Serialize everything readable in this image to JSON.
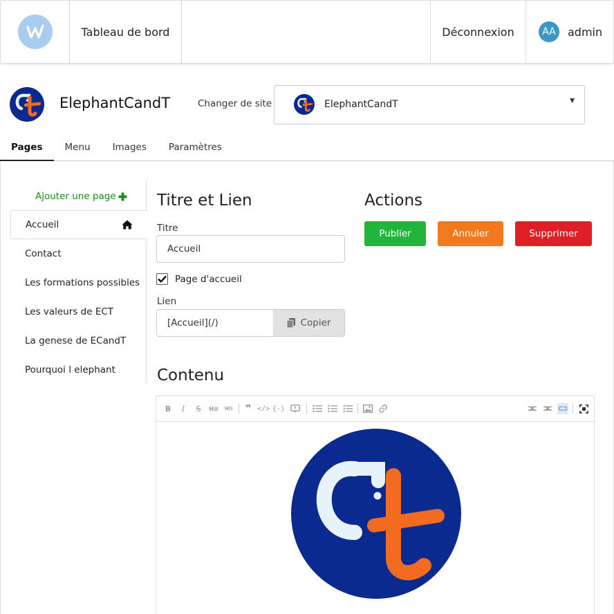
{
  "navbar": {
    "logo_icon": "w-logo-icon",
    "dashboard_label": "Tableau de bord",
    "logout_label": "Déconnexion",
    "avatar_initials": "AA",
    "username": "admin"
  },
  "site": {
    "name": "ElephantCandT",
    "change_label": "Changer de site :",
    "selected": "ElephantCandT",
    "brand_colors": {
      "navy": "#0b2a8f",
      "orange": "#f26b21",
      "light": "#e8f2fb"
    }
  },
  "tabs": [
    {
      "label": "Pages",
      "active": true
    },
    {
      "label": "Menu"
    },
    {
      "label": "Images"
    },
    {
      "label": "Paramètres"
    }
  ],
  "sidebar": {
    "add_page_label": "Ajouter une page",
    "items": [
      {
        "label": "Accueil",
        "active": true,
        "icon": "home-icon"
      },
      {
        "label": "Contact"
      },
      {
        "label": "Les formations possibles"
      },
      {
        "label": "Les valeurs de ECT"
      },
      {
        "label": "La genese de ECandT"
      },
      {
        "label": "Pourquoi l elephant"
      }
    ]
  },
  "form": {
    "section_title": "Titre et Lien",
    "title_label": "Titre",
    "title_value": "Accueil",
    "homepage_checkbox_label": "Page d'accueil",
    "homepage_checked": true,
    "link_label": "Lien",
    "link_value": "[Accueil](/)",
    "copy_label": "Copier"
  },
  "actions": {
    "title": "Actions",
    "publish_label": "Publier",
    "cancel_label": "Annuler",
    "delete_label": "Supprimer",
    "colors": {
      "publish": "#21b53c",
      "cancel": "#f07a1c",
      "delete": "#df1f26"
    }
  },
  "content": {
    "title": "Contenu",
    "toolbar_icons": [
      "bold-icon",
      "italic-icon",
      "strikethrough-icon",
      "heading-bigger-icon",
      "heading-smaller-icon",
      "quote-icon",
      "code-icon",
      "code-block-icon",
      "comment-icon",
      "bullet-list-icon",
      "numbered-list-icon",
      "checklist-icon",
      "image-icon",
      "link-icon",
      "toggle-preview-icon",
      "side-by-side-icon",
      "toggle-edit-icon",
      "fullscreen-icon"
    ]
  }
}
